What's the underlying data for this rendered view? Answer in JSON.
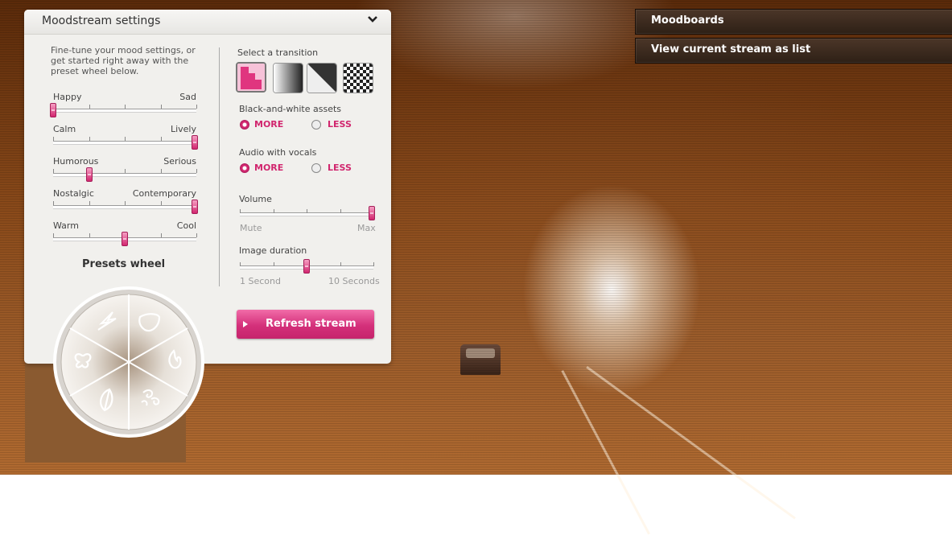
{
  "settings_panel": {
    "title": "Moodstream settings",
    "intro": "Fine-tune your mood settings, or get started right away with the preset wheel below.",
    "sliders": [
      {
        "left": "Happy",
        "right": "Sad",
        "value": 0.0
      },
      {
        "left": "Calm",
        "right": "Lively",
        "value": 1.0
      },
      {
        "left": "Humorous",
        "right": "Serious",
        "value": 0.25
      },
      {
        "left": "Nostalgic",
        "right": "Contemporary",
        "value": 1.0
      },
      {
        "left": "Warm",
        "right": "Cool",
        "value": 0.5
      }
    ],
    "presets_title": "Presets wheel",
    "preset_icons": [
      "lightning-icon",
      "drop-icon",
      "flame-icon",
      "swirl-icon",
      "leaf-icon",
      "butterfly-icon"
    ],
    "transition": {
      "label": "Select a transition",
      "options": [
        "stairs-transition",
        "fade-transition",
        "wipe-transition",
        "checker-transition"
      ],
      "selected": 0
    },
    "bw_assets": {
      "label": "Black-and-white assets",
      "more": "MORE",
      "less": "LESS",
      "selected": "more"
    },
    "audio_vocals": {
      "label": "Audio with vocals",
      "more": "MORE",
      "less": "LESS",
      "selected": "more"
    },
    "volume": {
      "label": "Volume",
      "min": "Mute",
      "max": "Max",
      "value": 1.0
    },
    "image_duration": {
      "label": "Image duration",
      "min": "1 Second",
      "max": "10 Seconds",
      "value": 0.5
    },
    "refresh_label": "Refresh stream",
    "accent_color": "#d1266e"
  },
  "top_nav": {
    "moodboards": "Moodboards",
    "view_list": "View current stream as list"
  }
}
